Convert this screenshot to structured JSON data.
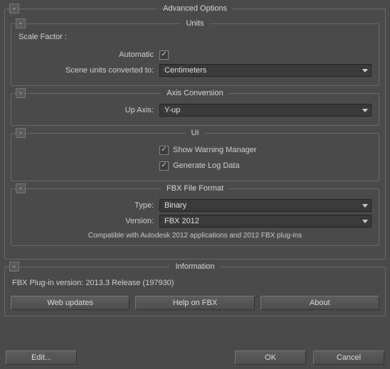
{
  "main": {
    "title": "Advanced Options",
    "collapse": "-"
  },
  "units": {
    "title": "Units",
    "collapse": "-",
    "scale_factor_label": "Scale Factor :",
    "automatic_label": "Automatic",
    "automatic_checked": true,
    "converted_label": "Scene units converted to:",
    "converted_value": "Centimeters"
  },
  "axis": {
    "title": "Axis Conversion",
    "collapse": "-",
    "up_axis_label": "Up Axis:",
    "up_axis_value": "Y-up"
  },
  "ui": {
    "title": "UI",
    "collapse": "-",
    "warning_label": "Show Warning Manager",
    "warning_checked": true,
    "log_label": "Generate Log Data",
    "log_checked": true
  },
  "fbx": {
    "title": "FBX File Format",
    "collapse": "-",
    "type_label": "Type:",
    "type_value": "Binary",
    "version_label": "Version:",
    "version_value": "FBX 2012",
    "compat_text": "Compatible with Autodesk 2012 applications and 2012 FBX plug-ins"
  },
  "info": {
    "title": "Information",
    "collapse": "-",
    "plugin_version": "FBX Plug-in version: 2013.3 Release (197930)",
    "web_updates": "Web updates",
    "help": "Help on FBX",
    "about": "About"
  },
  "footer": {
    "edit": "Edit...",
    "ok": "OK",
    "cancel": "Cancel"
  }
}
